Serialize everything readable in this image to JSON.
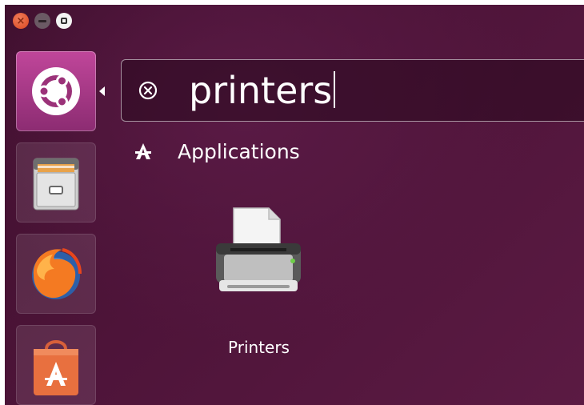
{
  "window_controls": {
    "close_icon": "close-icon",
    "minimize_icon": "minimize-icon",
    "maximize_icon": "maximize-icon"
  },
  "launcher": {
    "items": [
      {
        "name": "Dash",
        "icon": "ubuntu-logo-icon",
        "active": true
      },
      {
        "name": "Files",
        "icon": "file-cabinet-icon",
        "active": false
      },
      {
        "name": "Firefox",
        "icon": "firefox-icon",
        "active": false
      },
      {
        "name": "Ubuntu Software",
        "icon": "software-center-icon",
        "active": false
      }
    ]
  },
  "search": {
    "query": "printers",
    "clear_icon": "clear-search-icon"
  },
  "category": {
    "label": "Applications",
    "icon": "applications-icon"
  },
  "results": [
    {
      "label": "Printers",
      "icon": "printer-icon"
    }
  ],
  "colors": {
    "background": "#4e1439",
    "launcher_active": "#a63887",
    "close_button": "#e05a2f"
  }
}
